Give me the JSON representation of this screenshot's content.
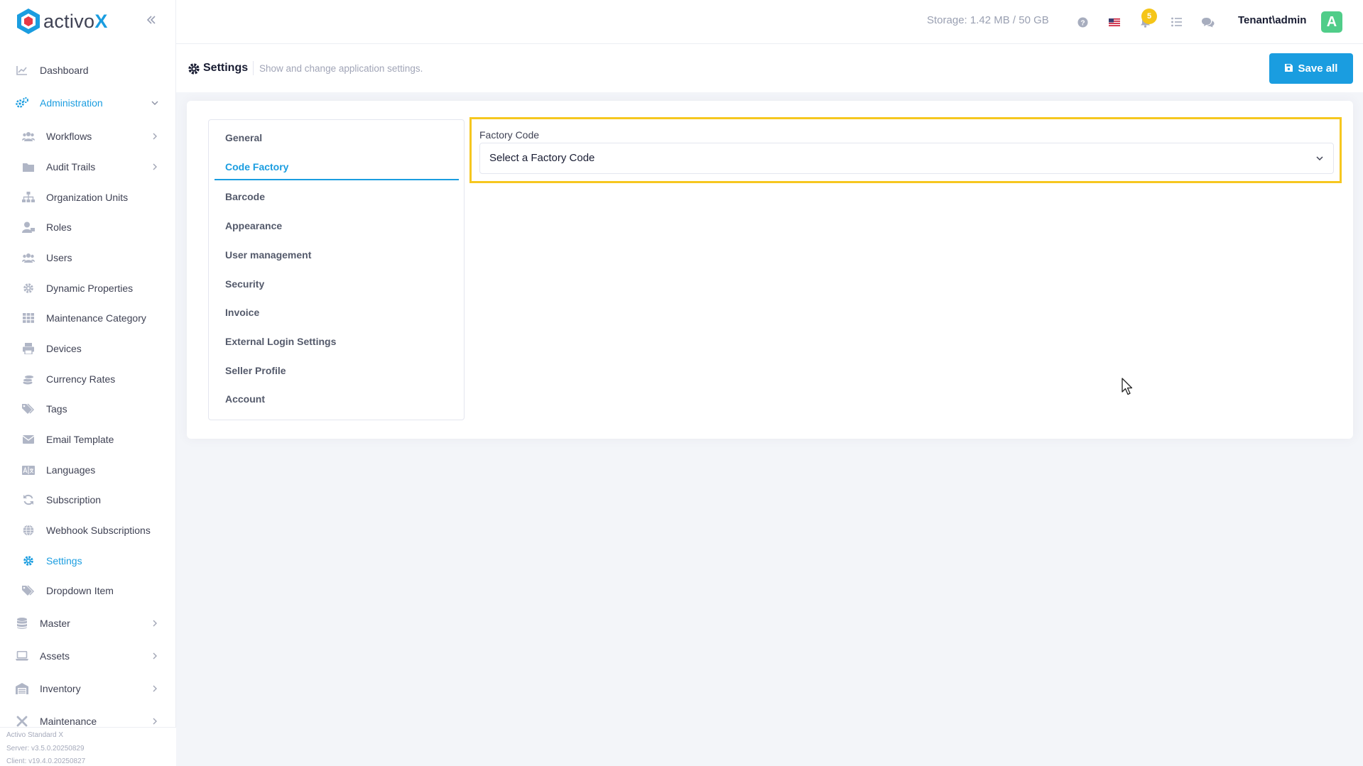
{
  "brand": {
    "name_prefix": "activo",
    "name_suffix": "X"
  },
  "sidebar": {
    "items": [
      {
        "label": "Dashboard",
        "icon": "chart-line-icon"
      },
      {
        "label": "Administration",
        "icon": "cogs-icon"
      },
      {
        "label": "Workflows",
        "icon": "users-group-icon"
      },
      {
        "label": "Audit Trails",
        "icon": "folder-icon"
      },
      {
        "label": "Organization Units",
        "icon": "sitemap-icon"
      },
      {
        "label": "Roles",
        "icon": "user-tag-icon"
      },
      {
        "label": "Users",
        "icon": "users-icon"
      },
      {
        "label": "Dynamic Properties",
        "icon": "gear-icon"
      },
      {
        "label": "Maintenance Category",
        "icon": "grid-icon"
      },
      {
        "label": "Devices",
        "icon": "printer-icon"
      },
      {
        "label": "Currency Rates",
        "icon": "coins-icon"
      },
      {
        "label": "Tags",
        "icon": "tags-icon"
      },
      {
        "label": "Email Template",
        "icon": "envelope-icon"
      },
      {
        "label": "Languages",
        "icon": "language-icon"
      },
      {
        "label": "Subscription",
        "icon": "sync-icon"
      },
      {
        "label": "Webhook Subscriptions",
        "icon": "globe-icon"
      },
      {
        "label": "Settings",
        "icon": "gear-icon"
      },
      {
        "label": "Dropdown Item",
        "icon": "tags-icon"
      },
      {
        "label": "Master",
        "icon": "database-icon"
      },
      {
        "label": "Assets",
        "icon": "laptop-icon"
      },
      {
        "label": "Inventory",
        "icon": "warehouse-icon"
      },
      {
        "label": "Maintenance",
        "icon": "tools-icon"
      }
    ]
  },
  "footer": {
    "product": "Activo Standard X",
    "server": "Server: v3.5.0.20250829",
    "client": "Client: v19.4.0.20250827"
  },
  "header": {
    "storage": "Storage: 1.42 MB / 50 GB",
    "notification_count": "5",
    "user": "Tenant\\admin",
    "avatar_letter": "A"
  },
  "subheader": {
    "title": "Settings",
    "description": "Show and change application settings.",
    "save_label": "Save all"
  },
  "settings_tabs": [
    "General",
    "Code Factory",
    "Barcode",
    "Appearance",
    "User management",
    "Security",
    "Invoice",
    "External Login Settings",
    "Seller Profile",
    "Account"
  ],
  "factory_code": {
    "label": "Factory Code",
    "selected": "Select a Factory Code"
  },
  "colors": {
    "accent": "#1a9de0",
    "highlight": "#f6c71f",
    "badge": "#f5c518",
    "avatar": "#50cd89"
  }
}
